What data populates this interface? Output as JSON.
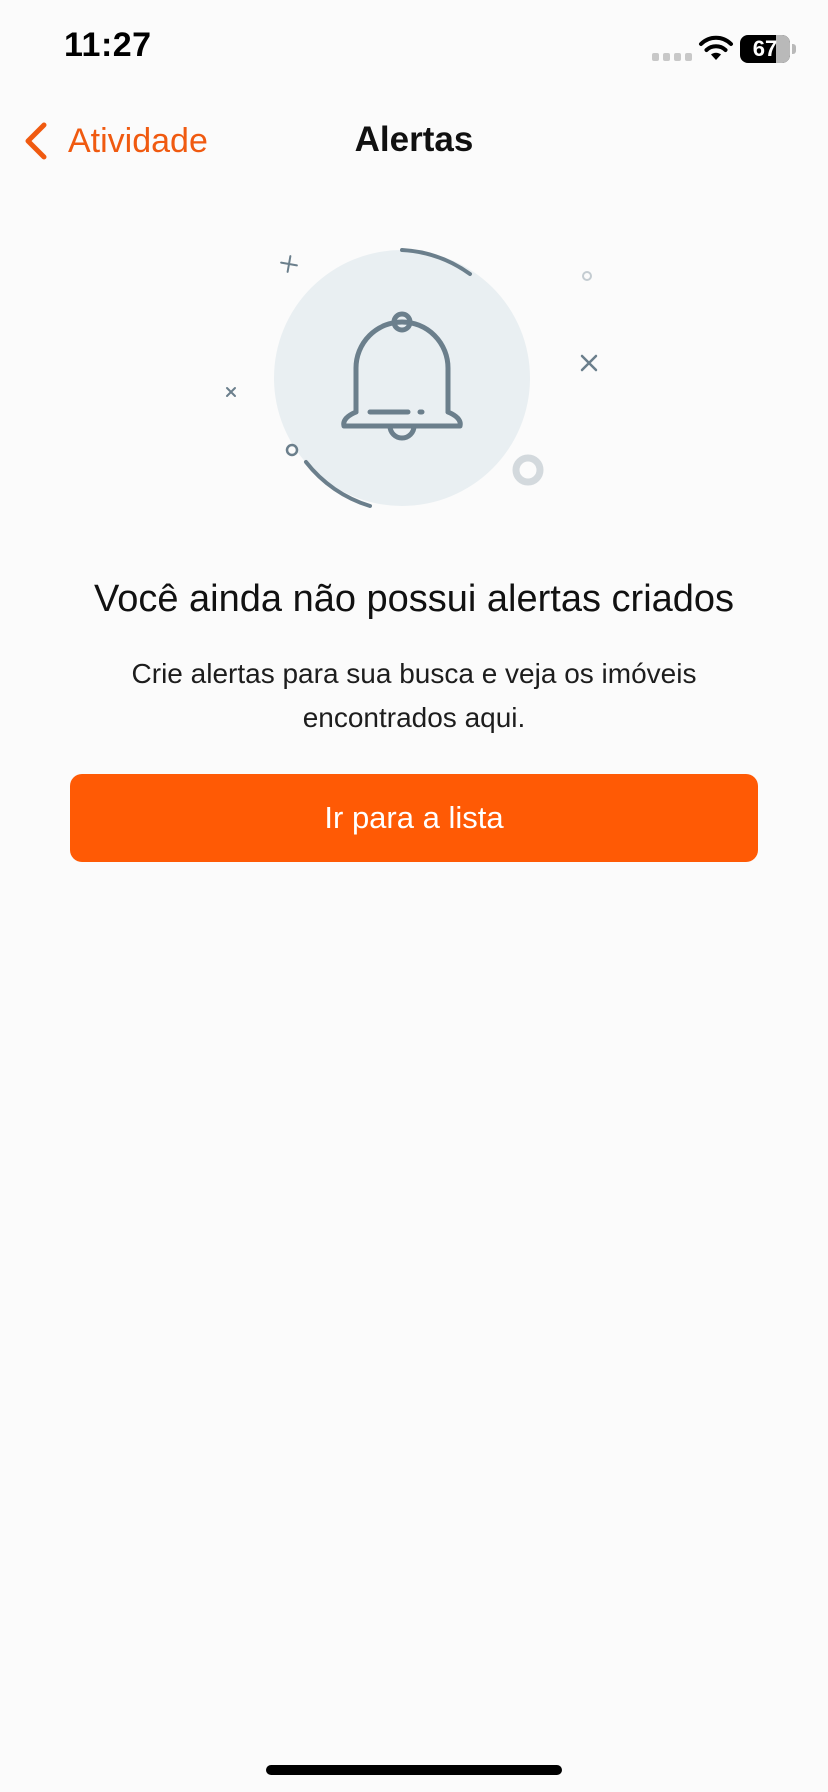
{
  "status_bar": {
    "time": "11:27",
    "battery_level": "67",
    "icons": [
      "signal-icon",
      "wifi-icon",
      "battery-icon"
    ]
  },
  "nav": {
    "back_label": "Atividade",
    "back_icon": "chevron-left-icon",
    "title": "Alertas"
  },
  "illustration": {
    "icon": "bell-icon"
  },
  "empty_state": {
    "title": "Você ainda não possui alertas criados",
    "description": "Crie alertas para sua busca e veja os imóveis encontrados aqui."
  },
  "cta": {
    "label": "Ir para a lista"
  },
  "colors": {
    "accent": "#ff5a05",
    "accent_text": "#f05a10",
    "background": "#fbfbfb",
    "illustration_circle": "#e9eff2",
    "illustration_stroke": "#6b7f8c"
  }
}
